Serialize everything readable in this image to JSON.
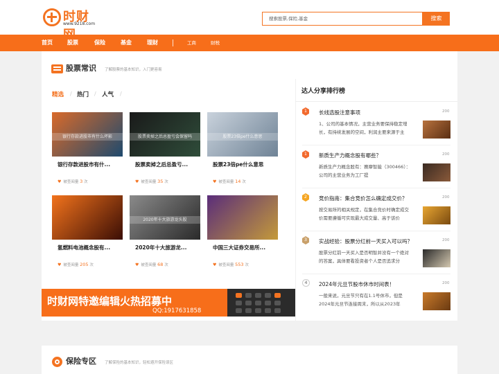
{
  "header": {
    "logo_name": "时财网",
    "logo_url": "www.9218.com",
    "search_placeholder": "搜索股票,保险,基金",
    "search_button": "搜索"
  },
  "nav": {
    "items": [
      "首页",
      "股票",
      "保险",
      "基金",
      "理财"
    ],
    "sub_items": [
      "工商",
      "财税"
    ]
  },
  "stock_section": {
    "title": "股票常识",
    "subtitle": "了解股票的基本知识，入门更容易",
    "tabs": [
      "精选",
      "热门",
      "人气"
    ],
    "views_label": "被查阅量",
    "views_unit": "次",
    "cards": [
      {
        "title": "银行存款进股市有什...",
        "views": "3",
        "overlay": "银行存款进股市有什么坏影",
        "colors": [
          "#d96a2a",
          "#1e4a6e"
        ]
      },
      {
        "title": "股票卖掉之后总盈亏...",
        "views": "35",
        "overlay": "股票卖掉之后总盈亏会保留吗",
        "colors": [
          "#1a1a1a",
          "#2f4d3a"
        ]
      },
      {
        "title": "股票23倍pe什么意思",
        "views": "14",
        "overlay": "股票23倍pe什么意思",
        "colors": [
          "#c9d2dc",
          "#6f8396"
        ]
      },
      {
        "title": "氢燃料电池概念股有...",
        "views": "205",
        "overlay": "",
        "colors": [
          "#f2731c",
          "#3b0e05"
        ]
      },
      {
        "title": "2020年十大旅游龙...",
        "views": "68",
        "overlay": "2020年十大旅游龙头股",
        "colors": [
          "#8a8a8a",
          "#2a2a2a"
        ]
      },
      {
        "title": "中国三大证券交易所...",
        "views": "553",
        "overlay": "",
        "colors": [
          "#5a2d7a",
          "#c49a3a"
        ]
      }
    ]
  },
  "banner": {
    "text": "时财网特邀编辑火热招募中",
    "qq": "QQ:1917631858"
  },
  "ranking": {
    "title": "达人分享排行榜",
    "items": [
      {
        "rank": "1",
        "title": "长线选股注意事项",
        "count": "200",
        "desc": "1、公司的基本情况，主营业务要保持稳定增长，有持续发展的空间，利润主要来源于主",
        "badge_color": "#f26a2e",
        "thumb": [
          "#b8723e",
          "#5a2e12"
        ]
      },
      {
        "rank": "1",
        "title": "新质生产力概念股有哪些？",
        "count": "200",
        "desc": "新质生产力概念股有：赛摩智能（300466）：公司的主营业务为工厂提",
        "badge_color": "#f26a2e",
        "thumb": [
          "#3a2a22",
          "#8a5a3a"
        ]
      },
      {
        "rank": "2",
        "title": "竞价指南：集合竞价怎么确定成交价？",
        "count": "200",
        "desc": "按交易所的相关规定，在集合竞价时确定成交价需要遵循可实现最大成交量、高于该价",
        "badge_color": "#f5a623",
        "thumb": [
          "#e8a632",
          "#7a4a10"
        ]
      },
      {
        "rank": "3",
        "title": "实战经验：股票分红前一天买入可以吗？",
        "count": "200",
        "desc": "股票分红前一天买入是否明智并没有一个绝对的答案，具体要看投资者个人是否追求分",
        "badge_color": "#c9a06a",
        "thumb": [
          "#2a2a2a",
          "#d4c8b0"
        ]
      },
      {
        "rank": "4",
        "title": "2024年元旦节股市休市时间表！",
        "count": "200",
        "desc": "一般来说，元旦节只有在1.1号休市，但是2024年元旦节连接周末，所以从2023年",
        "badge_color": "",
        "thumb": [
          "#c97a2a",
          "#6a3a12"
        ]
      }
    ]
  },
  "insurance_section": {
    "title": "保险专区",
    "subtitle": "了解保险的基本知识，轻松避开保险误区"
  },
  "colors": {
    "accent": "#f47321",
    "nav_bg": "#f76e1a"
  }
}
